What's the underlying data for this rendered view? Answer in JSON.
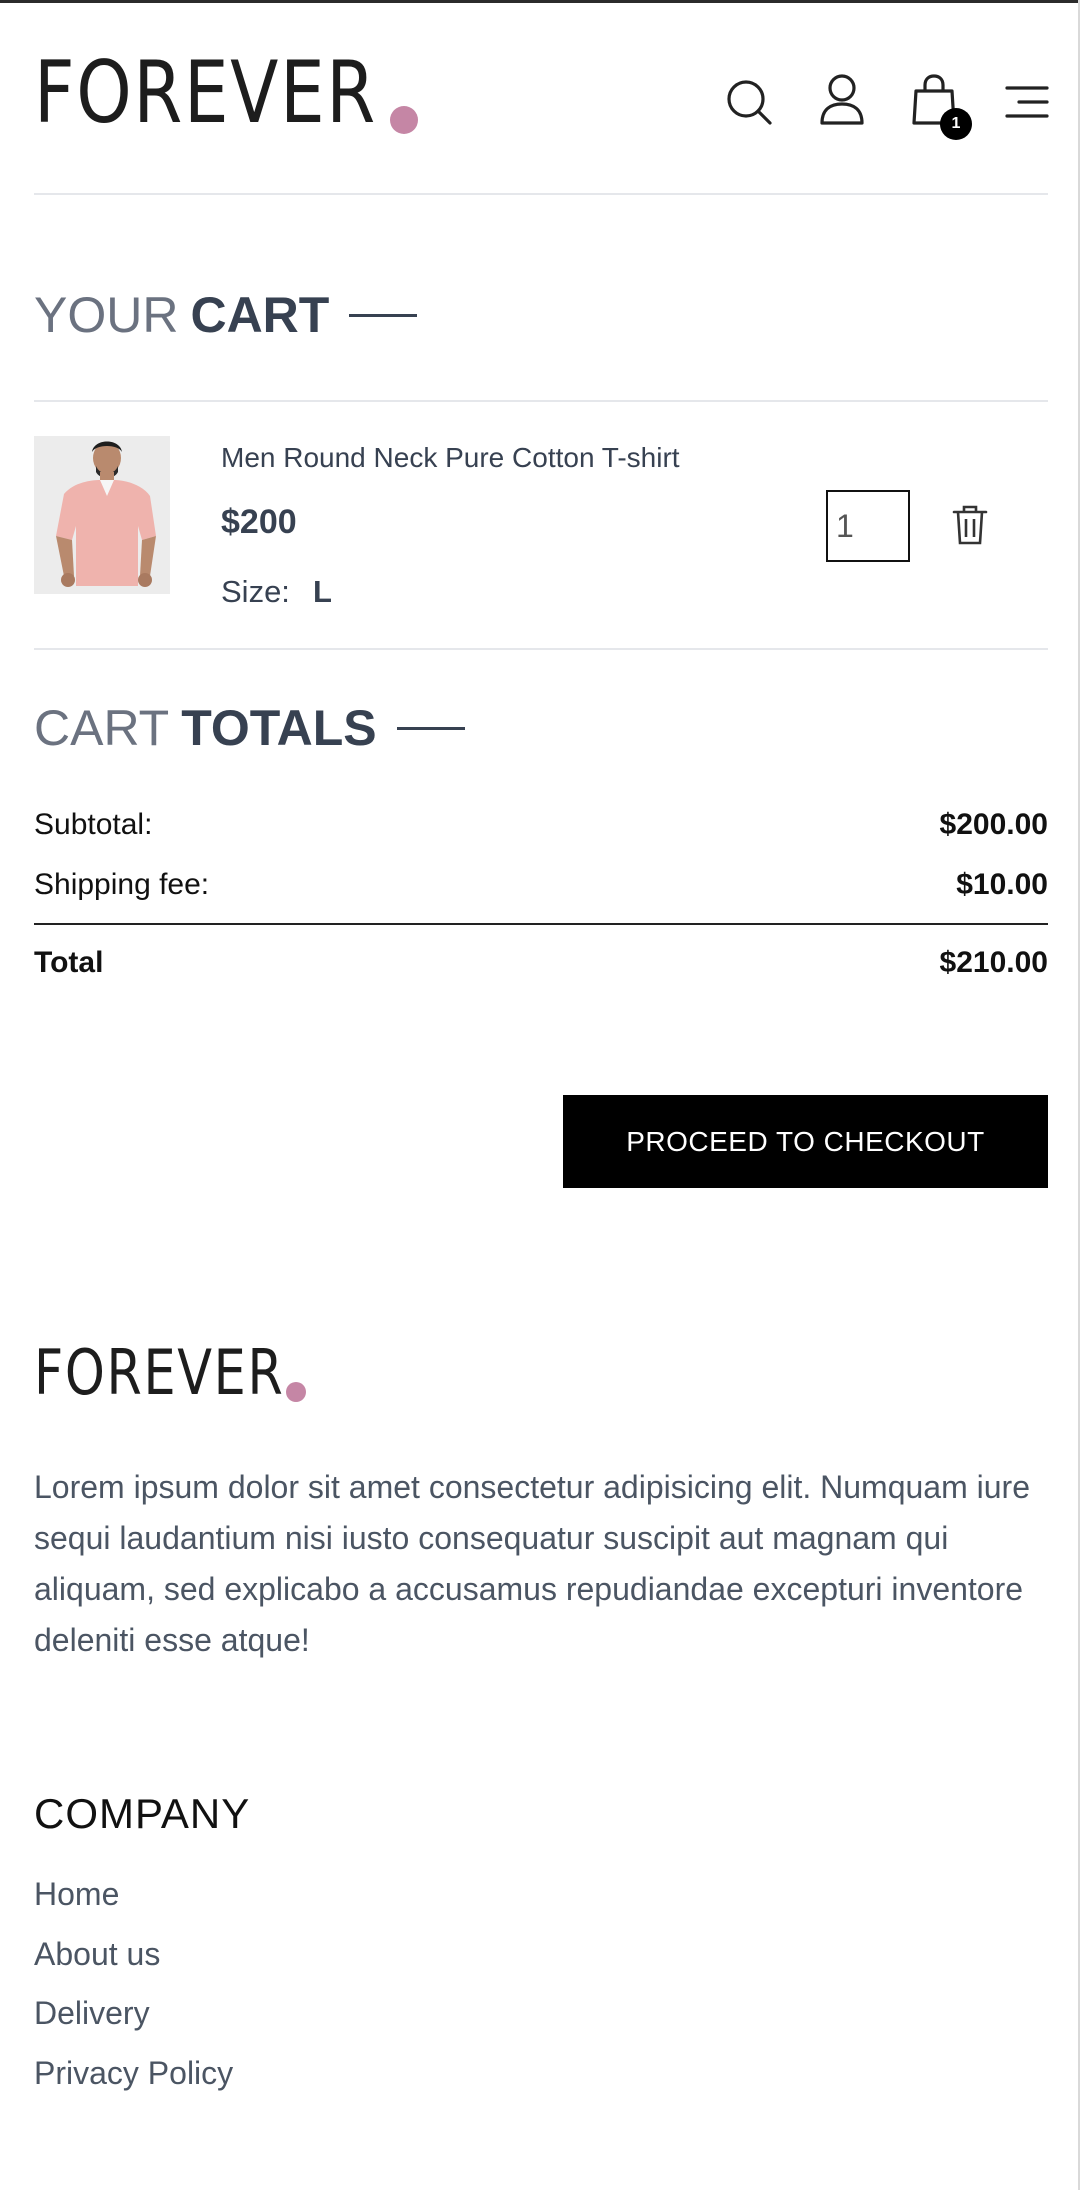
{
  "brand": {
    "logo_text": "FOREVER",
    "dot_color": "#c586a5"
  },
  "header": {
    "icons": [
      "search-icon",
      "user-icon",
      "shopping-bag-icon",
      "menu-icon"
    ],
    "cart_count": "1"
  },
  "cart": {
    "title_light": "YOUR",
    "title_bold": "CART",
    "items": [
      {
        "name": "Men Round Neck Pure Cotton T-shirt",
        "price": "$200",
        "size_label": "Size:",
        "size": "L",
        "quantity": "1"
      }
    ]
  },
  "totals": {
    "title_light": "CART",
    "title_bold": "TOTALS",
    "subtotal_label": "Subtotal:",
    "subtotal_value": "$200.00",
    "shipping_label": "Shipping fee:",
    "shipping_value": "$10.00",
    "total_label": "Total",
    "total_value": "$210.00",
    "checkout_label": "PROCEED TO CHECKOUT"
  },
  "footer": {
    "logo_text": "FOREVER",
    "description": "Lorem ipsum dolor sit amet consectetur adipisicing elit. Numquam iure sequi laudantium nisi iusto consequatur suscipit aut magnam qui aliquam, sed explicabo a accusamus repudiandae excepturi inventore deleniti esse atque!",
    "company_heading": "COMPANY",
    "links": [
      "Home",
      "About us",
      "Delivery",
      "Privacy Policy"
    ]
  }
}
